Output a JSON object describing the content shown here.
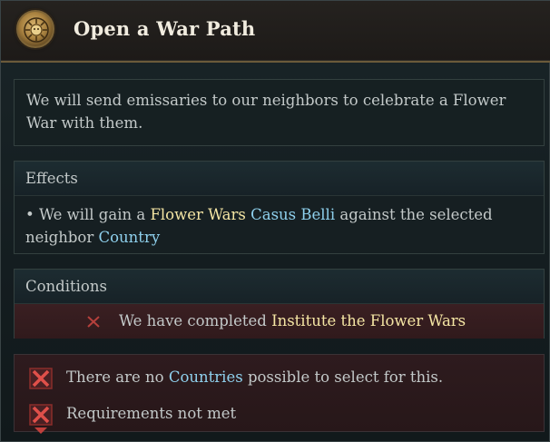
{
  "header": {
    "title": "Open a War Path",
    "emblem_icon": "sun-emblem-icon"
  },
  "description": {
    "text": "We will send emissaries to our neighbors to celebrate a Flower War with them."
  },
  "effects": {
    "heading": "Effects",
    "bullet": "•",
    "line_part1": "We will gain a",
    "flower_wars": "Flower Wars",
    "casus_belli": "Casus Belli",
    "line_part2": "against the selected",
    "line_part3": "neighbor",
    "country": "Country"
  },
  "conditions": {
    "heading": "Conditions",
    "item_prefix": "We have completed",
    "item_link": "Institute the Flower Wars",
    "status_icon": "x-mark-icon"
  },
  "failures": {
    "row1_prefix": "There are no",
    "row1_link": "Countries",
    "row1_suffix": "possible to select for this.",
    "row2": "Requirements not met",
    "icon": "red-x-box-icon"
  },
  "colors": {
    "highlight_yellow": "#f5e6a4",
    "highlight_blue": "#8fd1ee",
    "fail_red": "#c0403c"
  }
}
